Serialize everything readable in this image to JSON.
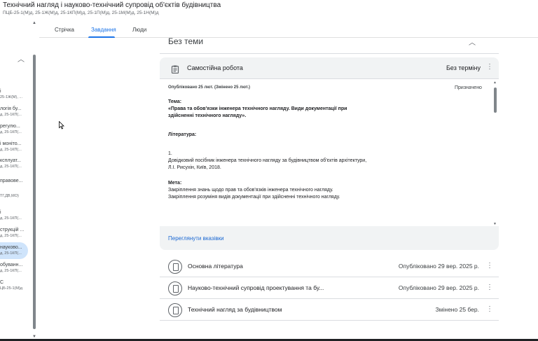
{
  "header": {
    "title": "Технічний нагляд і науково-технічний супровід об'єктів будівництва",
    "subtitle": "ПЦБ-25-1(М)д, 25-1Ж(М)д, 25-1КП(М)д, 25-1П(М)д, 25-1М(М)д, 25-1Н(М)д"
  },
  "sidebar": {
    "items": [
      {
        "l1": "і",
        "l2": "25-1Ж(М), ..."
      },
      {
        "l1": "логія бу...",
        "l2": "д, 25-1КП(..."
      },
      {
        "l1": "регулю...",
        "l2": "д, 25-1КП(..."
      },
      {
        "l1": "і моніто...",
        "l2": "д, 25-1КП(..."
      },
      {
        "l1": "ксплуат...",
        "l2": "д, 25-1КП(..."
      },
      {
        "l1": "правове...",
        "l2": ""
      },
      {
        "l1": "",
        "l2": "ТГ,ДВ,МО)"
      },
      {
        "l1": "і",
        "l2": "д, 25-1КП(..."
      },
      {
        "l1": "струкцій ...",
        "l2": "д, 25-1КП(..."
      },
      {
        "l1": "науково...",
        "l2": "д, 25-1КП(..."
      },
      {
        "l1": "обуванн...",
        "l2": "д, 25-1КП(..."
      },
      {
        "l1": "С",
        "l2": "ЦБ-25-1(М)д"
      }
    ]
  },
  "tabs": [
    "Стрічка",
    "Завдання",
    "Люди"
  ],
  "topic": {
    "title": "Без теми"
  },
  "assignment": {
    "title": "Самостійна робота",
    "due": "Без терміну",
    "posted": "Опубліковано 25 лют. (Змінено 25 лют.)",
    "status": "Призначено",
    "topic_label": "Тема:",
    "topic_text": "«Права та обов'язки інженера технічного нагляду. Види документації при здійсненні технічного нагляду».",
    "lit_label": "Література:",
    "lit_num": "1.",
    "lit_text": "Довідковий посібник інженера технічного нагляду за будівництвом об'єктів архітектури, Л.І. Рисухін, Київ, 2018.",
    "goal_label": "Мета:",
    "goal_line1": "Закріплення знань щодо прав та обов'язків інженера технічного нагляду.",
    "goal_line2": "Закріплення розуміня видів документації при здійсненні технічного нагляду.",
    "view_link": "Переглянути вказівки"
  },
  "materials": [
    {
      "title": "Основна література",
      "date": "Опубліковано 29 вер. 2025 р."
    },
    {
      "title": "Науково-технічний супровід проектування та бу...",
      "date": "Опубліковано 29 вер. 2025 р."
    },
    {
      "title": "Технічний нагляд за будівництвом",
      "date": "Змінено 25 бер."
    }
  ]
}
